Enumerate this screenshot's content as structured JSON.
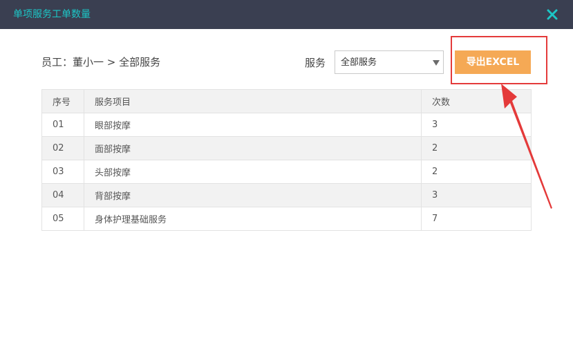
{
  "dialog": {
    "title": "单项服务工单数量"
  },
  "breadcrumb": "员工：董小一 > 全部服务",
  "filter": {
    "label": "服务",
    "selected": "全部服务"
  },
  "export_button": "导出EXCEL",
  "table": {
    "headers": [
      "序号",
      "服务项目",
      "次数"
    ],
    "rows": [
      [
        "01",
        "眼部按摩",
        "3"
      ],
      [
        "02",
        "面部按摩",
        "2"
      ],
      [
        "03",
        "头部按摩",
        "2"
      ],
      [
        "04",
        "背部按摩",
        "3"
      ],
      [
        "05",
        "身体护理基础服务",
        "7"
      ]
    ]
  },
  "colors": {
    "titlebar_bg": "#3a3f51",
    "title_text": "#1cc6c6",
    "export_button": "#f5a955",
    "annotation_red": "#e43a3a"
  },
  "icons": {
    "close": "close-icon",
    "dropdown": "triangle-down-icon"
  }
}
